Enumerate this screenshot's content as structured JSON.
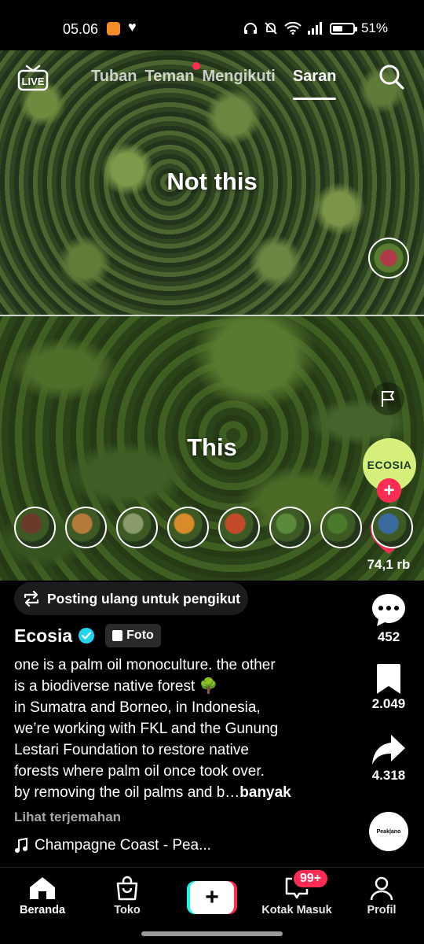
{
  "status_bar": {
    "time": "05.06",
    "battery_level": 0.51,
    "battery_text": "51%"
  },
  "top_nav": {
    "live_label": "LIVE",
    "tabs": [
      {
        "label": "Tuban",
        "active": false
      },
      {
        "label": "Teman",
        "active": false,
        "notification_dot": true
      },
      {
        "label": "Mengikuti",
        "active": false
      },
      {
        "label": "Saran",
        "active": true
      }
    ]
  },
  "post": {
    "caption_top": "Not this",
    "caption_bottom": "This",
    "avatar_text": "ECOSIA",
    "likes": "74,1 rb",
    "comments": "452",
    "bookmarks": "2.049",
    "shares": "4.318",
    "repost_label": "Posting ulang untuk pengikut",
    "author": "Ecosia",
    "type_label": "Foto",
    "description": [
      "one is a palm oil monoculture. the other",
      "is a biodiverse native forest 🌳",
      "in Sumatra and Borneo, in Indonesia,",
      "we’re working with FKL and the Gunung",
      "Lestari Foundation to restore native",
      "forests where palm oil once took over.",
      "by removing the oil palms and b…"
    ],
    "more_label": "banyak",
    "translate_label": "Lihat terjemahan",
    "music": "Champagne Coast - Pea...",
    "thumbnails": [
      {
        "name": "thumb-red-berries",
        "color": "#6b3a2a"
      },
      {
        "name": "thumb-fruit-bunch",
        "color": "#b57a3a"
      },
      {
        "name": "thumb-hanging-plant",
        "color": "#8a9a6a"
      },
      {
        "name": "thumb-orange-flowers",
        "color": "#d98a2a"
      },
      {
        "name": "thumb-red-fruit",
        "color": "#c24a2a"
      },
      {
        "name": "thumb-green-bark",
        "color": "#5a8a3a"
      },
      {
        "name": "thumb-leaves",
        "color": "#4a7a2a"
      },
      {
        "name": "thumb-tree",
        "color": "#3a6aa0"
      }
    ]
  },
  "bottom_nav": {
    "home": "Beranda",
    "shop": "Toko",
    "inbox": "Kotak Masuk",
    "inbox_badge": "99+",
    "profile": "Profil"
  },
  "colors": {
    "accent": "#fe2c55",
    "cyan": "#25f4ee",
    "verified": "#20d5ec",
    "avatar_bg": "#d6ef7a"
  }
}
